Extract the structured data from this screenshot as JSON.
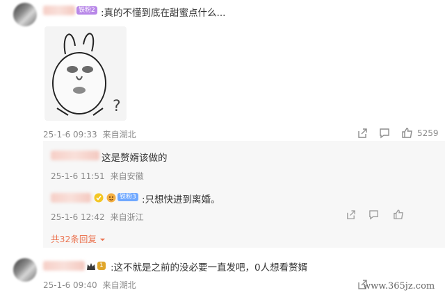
{
  "comments": [
    {
      "badge": "铁粉2",
      "text": ":真的不懂到底在甜蜜点什么...",
      "date": "25-1-6 09:33",
      "location": "来自湖北",
      "likes": "5259"
    },
    {
      "badge": "1",
      "text": ":这不就是之前的没必要一直发吧，0人想看赘婿",
      "date": "25-1-6 09:40",
      "location": "来自湖北"
    }
  ],
  "replies": [
    {
      "text": "这是赘婿该做的",
      "date": "25-1-6 11:51",
      "location": "来自安徽"
    },
    {
      "badge": "铁粉3",
      "text": ":只想快进到离婚。",
      "date": "25-1-6 12:42",
      "location": "来自浙江"
    }
  ],
  "more_replies": "共32条回复",
  "watermark": "www.365jz.com",
  "colors": {
    "badge_purple": "#b887e8",
    "badge_blue": "#6fa8ff",
    "badge_gold": "#e0a62a",
    "more_link": "#eb7350"
  },
  "icons": [
    "share-icon",
    "comment-icon",
    "like-icon",
    "chevron-down-icon"
  ]
}
